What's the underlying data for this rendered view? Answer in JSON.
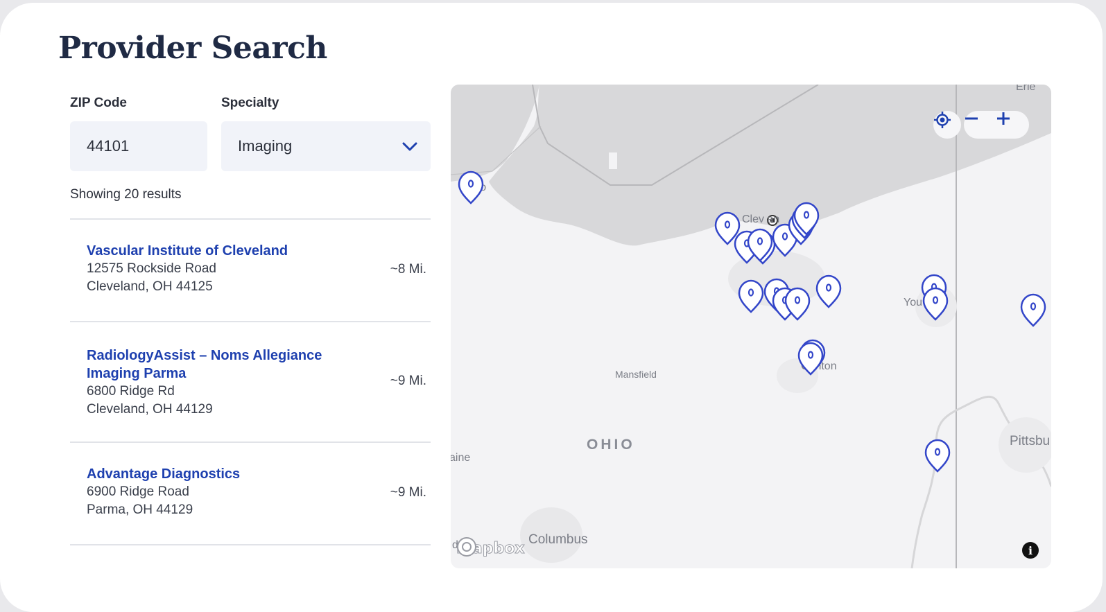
{
  "page": {
    "title": "Provider Search"
  },
  "filters": {
    "zip_label": "ZIP Code",
    "zip_value": "44101",
    "specialty_label": "Specialty",
    "specialty_value": "Imaging"
  },
  "results": {
    "count_text": "Showing 20 results",
    "items": [
      {
        "name": "Vascular Institute of Cleveland",
        "address1": "12575 Rockside Road",
        "address2": "Cleveland, OH 44125",
        "distance": "~8 Mi."
      },
      {
        "name": "RadiologyAssist – Noms Allegiance Imaging Parma",
        "address1": "6800 Ridge Rd",
        "address2": "Cleveland, OH 44129",
        "distance": "~9 Mi."
      },
      {
        "name": "Advantage Diagnostics",
        "address1": "6900 Ridge Road",
        "address2": "Parma, OH 44129",
        "distance": "~9 Mi."
      }
    ]
  },
  "map": {
    "labels": {
      "erie": "Erie",
      "toledo": "To  do",
      "cleveland": "Clev  an",
      "akron": "n",
      "youngstown": "You      own",
      "canton": "Canton",
      "mansfield": "Mansfield",
      "ohio": "OHIO",
      "lorain": "aine",
      "pittsburgh": "Pittsbu",
      "columbus": "Columbus",
      "d": "d"
    },
    "attribution": "mapbox",
    "marker_color": "#3346c9",
    "water_color": "#d8d8da",
    "land_color": "#f3f3f5",
    "marker_count": 20
  },
  "icons": {
    "locate": "crosshair-icon",
    "zoom_out": "minus-icon",
    "zoom_in": "plus-icon",
    "dropdown": "chevron-down-icon",
    "info": "info-icon"
  }
}
